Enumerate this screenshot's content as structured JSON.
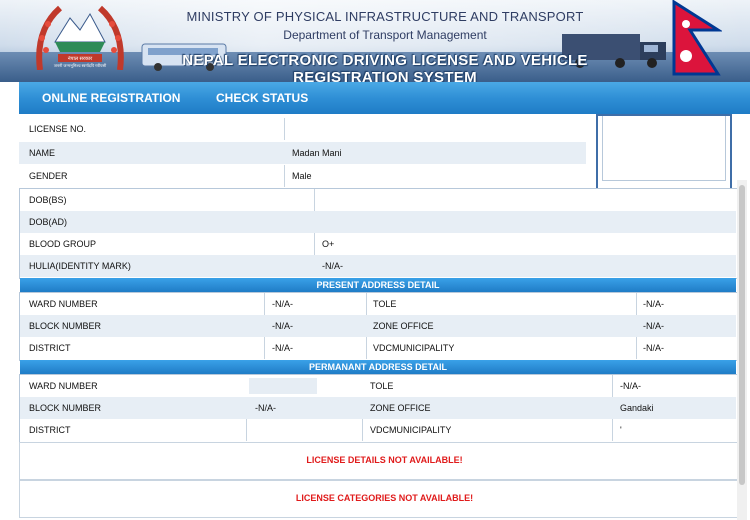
{
  "header": {
    "ministry": "MINISTRY OF PHYSICAL INFRASTRUCTURE AND TRANSPORT",
    "department": "Department of Transport Management",
    "system_title": "NEPAL ELECTRONIC DRIVING LICENSE AND VEHICLE REGISTRATION SYSTEM",
    "emblem_caption": "नेपाल सरकार",
    "emblem_subcaption": "जननी जन्मभूमिश्च स्वर्गादपि गरीयसी"
  },
  "nav": {
    "online_registration": "ONLINE REGISTRATION",
    "check_status": "CHECK STATUS"
  },
  "personal": {
    "license_no_label": "LICENSE NO.",
    "license_no_value": "",
    "name_label": "NAME",
    "name_value": "Madan Mani",
    "gender_label": "GENDER",
    "gender_value": "Male",
    "dob_bs_label": "DOB(BS)",
    "dob_bs_value": "",
    "dob_ad_label": "DOB(AD)",
    "dob_ad_value": "",
    "blood_group_label": "BLOOD GROUP",
    "blood_group_value": "O+",
    "hulia_label": "HULIA(IDENTITY MARK)",
    "hulia_value": "-N/A-"
  },
  "present_address": {
    "title": "PRESENT ADDRESS DETAIL",
    "ward_label": "WARD NUMBER",
    "ward_value": "-N/A-",
    "tole_label": "TOLE",
    "tole_value": "-N/A-",
    "block_label": "BLOCK NUMBER",
    "block_value": "-N/A-",
    "zone_label": "ZONE OFFICE",
    "zone_value": "-N/A-",
    "district_label": "DISTRICT",
    "district_value": "-N/A-",
    "vdc_label": "VDCMUNICIPALITY",
    "vdc_value": "-N/A-"
  },
  "permanent_address": {
    "title": "PERMANANT ADDRESS DETAIL",
    "ward_label": "WARD NUMBER",
    "ward_value": "",
    "tole_label": "TOLE",
    "tole_value": "-N/A-",
    "block_label": "BLOCK NUMBER",
    "block_value": "-N/A-",
    "zone_label": "ZONE OFFICE",
    "zone_value": "Gandaki",
    "district_label": "DISTRICT",
    "district_value": "",
    "vdc_label": "VDCMUNICIPALITY",
    "vdc_value": "'"
  },
  "messages": {
    "license_details": "LICENSE DETAILS NOT AVAILABLE!",
    "license_categories": "LICENSE CATEGORIES NOT AVAILABLE!"
  },
  "colors": {
    "nav_blue": "#2f8fd6",
    "section_blue": "#1f7cc6",
    "alert_red": "#e01b1b",
    "row_alt": "#e7eef5"
  }
}
